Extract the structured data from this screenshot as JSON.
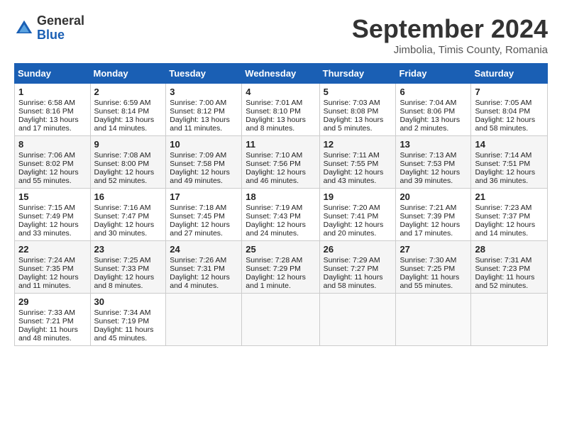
{
  "logo": {
    "general": "General",
    "blue": "Blue"
  },
  "title": "September 2024",
  "subtitle": "Jimbolia, Timis County, Romania",
  "weekdays": [
    "Sunday",
    "Monday",
    "Tuesday",
    "Wednesday",
    "Thursday",
    "Friday",
    "Saturday"
  ],
  "weeks": [
    [
      {
        "day": "1",
        "lines": [
          "Sunrise: 6:58 AM",
          "Sunset: 8:16 PM",
          "Daylight: 13 hours",
          "and 17 minutes."
        ]
      },
      {
        "day": "2",
        "lines": [
          "Sunrise: 6:59 AM",
          "Sunset: 8:14 PM",
          "Daylight: 13 hours",
          "and 14 minutes."
        ]
      },
      {
        "day": "3",
        "lines": [
          "Sunrise: 7:00 AM",
          "Sunset: 8:12 PM",
          "Daylight: 13 hours",
          "and 11 minutes."
        ]
      },
      {
        "day": "4",
        "lines": [
          "Sunrise: 7:01 AM",
          "Sunset: 8:10 PM",
          "Daylight: 13 hours",
          "and 8 minutes."
        ]
      },
      {
        "day": "5",
        "lines": [
          "Sunrise: 7:03 AM",
          "Sunset: 8:08 PM",
          "Daylight: 13 hours",
          "and 5 minutes."
        ]
      },
      {
        "day": "6",
        "lines": [
          "Sunrise: 7:04 AM",
          "Sunset: 8:06 PM",
          "Daylight: 13 hours",
          "and 2 minutes."
        ]
      },
      {
        "day": "7",
        "lines": [
          "Sunrise: 7:05 AM",
          "Sunset: 8:04 PM",
          "Daylight: 12 hours",
          "and 58 minutes."
        ]
      }
    ],
    [
      {
        "day": "8",
        "lines": [
          "Sunrise: 7:06 AM",
          "Sunset: 8:02 PM",
          "Daylight: 12 hours",
          "and 55 minutes."
        ]
      },
      {
        "day": "9",
        "lines": [
          "Sunrise: 7:08 AM",
          "Sunset: 8:00 PM",
          "Daylight: 12 hours",
          "and 52 minutes."
        ]
      },
      {
        "day": "10",
        "lines": [
          "Sunrise: 7:09 AM",
          "Sunset: 7:58 PM",
          "Daylight: 12 hours",
          "and 49 minutes."
        ]
      },
      {
        "day": "11",
        "lines": [
          "Sunrise: 7:10 AM",
          "Sunset: 7:56 PM",
          "Daylight: 12 hours",
          "and 46 minutes."
        ]
      },
      {
        "day": "12",
        "lines": [
          "Sunrise: 7:11 AM",
          "Sunset: 7:55 PM",
          "Daylight: 12 hours",
          "and 43 minutes."
        ]
      },
      {
        "day": "13",
        "lines": [
          "Sunrise: 7:13 AM",
          "Sunset: 7:53 PM",
          "Daylight: 12 hours",
          "and 39 minutes."
        ]
      },
      {
        "day": "14",
        "lines": [
          "Sunrise: 7:14 AM",
          "Sunset: 7:51 PM",
          "Daylight: 12 hours",
          "and 36 minutes."
        ]
      }
    ],
    [
      {
        "day": "15",
        "lines": [
          "Sunrise: 7:15 AM",
          "Sunset: 7:49 PM",
          "Daylight: 12 hours",
          "and 33 minutes."
        ]
      },
      {
        "day": "16",
        "lines": [
          "Sunrise: 7:16 AM",
          "Sunset: 7:47 PM",
          "Daylight: 12 hours",
          "and 30 minutes."
        ]
      },
      {
        "day": "17",
        "lines": [
          "Sunrise: 7:18 AM",
          "Sunset: 7:45 PM",
          "Daylight: 12 hours",
          "and 27 minutes."
        ]
      },
      {
        "day": "18",
        "lines": [
          "Sunrise: 7:19 AM",
          "Sunset: 7:43 PM",
          "Daylight: 12 hours",
          "and 24 minutes."
        ]
      },
      {
        "day": "19",
        "lines": [
          "Sunrise: 7:20 AM",
          "Sunset: 7:41 PM",
          "Daylight: 12 hours",
          "and 20 minutes."
        ]
      },
      {
        "day": "20",
        "lines": [
          "Sunrise: 7:21 AM",
          "Sunset: 7:39 PM",
          "Daylight: 12 hours",
          "and 17 minutes."
        ]
      },
      {
        "day": "21",
        "lines": [
          "Sunrise: 7:23 AM",
          "Sunset: 7:37 PM",
          "Daylight: 12 hours",
          "and 14 minutes."
        ]
      }
    ],
    [
      {
        "day": "22",
        "lines": [
          "Sunrise: 7:24 AM",
          "Sunset: 7:35 PM",
          "Daylight: 12 hours",
          "and 11 minutes."
        ]
      },
      {
        "day": "23",
        "lines": [
          "Sunrise: 7:25 AM",
          "Sunset: 7:33 PM",
          "Daylight: 12 hours",
          "and 8 minutes."
        ]
      },
      {
        "day": "24",
        "lines": [
          "Sunrise: 7:26 AM",
          "Sunset: 7:31 PM",
          "Daylight: 12 hours",
          "and 4 minutes."
        ]
      },
      {
        "day": "25",
        "lines": [
          "Sunrise: 7:28 AM",
          "Sunset: 7:29 PM",
          "Daylight: 12 hours",
          "and 1 minute."
        ]
      },
      {
        "day": "26",
        "lines": [
          "Sunrise: 7:29 AM",
          "Sunset: 7:27 PM",
          "Daylight: 11 hours",
          "and 58 minutes."
        ]
      },
      {
        "day": "27",
        "lines": [
          "Sunrise: 7:30 AM",
          "Sunset: 7:25 PM",
          "Daylight: 11 hours",
          "and 55 minutes."
        ]
      },
      {
        "day": "28",
        "lines": [
          "Sunrise: 7:31 AM",
          "Sunset: 7:23 PM",
          "Daylight: 11 hours",
          "and 52 minutes."
        ]
      }
    ],
    [
      {
        "day": "29",
        "lines": [
          "Sunrise: 7:33 AM",
          "Sunset: 7:21 PM",
          "Daylight: 11 hours",
          "and 48 minutes."
        ]
      },
      {
        "day": "30",
        "lines": [
          "Sunrise: 7:34 AM",
          "Sunset: 7:19 PM",
          "Daylight: 11 hours",
          "and 45 minutes."
        ]
      },
      {
        "day": "",
        "lines": []
      },
      {
        "day": "",
        "lines": []
      },
      {
        "day": "",
        "lines": []
      },
      {
        "day": "",
        "lines": []
      },
      {
        "day": "",
        "lines": []
      }
    ]
  ]
}
